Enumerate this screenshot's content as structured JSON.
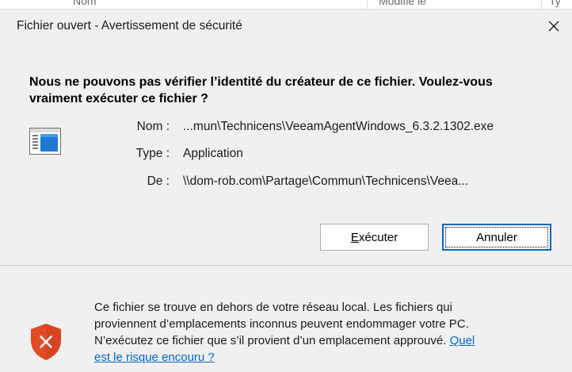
{
  "background_window": {
    "col1": "Nom",
    "col2": "Modifié le",
    "col3": "Ty"
  },
  "dialog": {
    "title": "Fichier ouvert - Avertissement de sécurité",
    "heading_line1": "Nous ne pouvons pas vérifier l’identité du créateur de ce fichier. Voulez-vous",
    "heading_line2": "vraiment exécuter ce fichier ?",
    "file_icon": "application-window-icon",
    "fields": [
      {
        "label": "Nom :",
        "value": "...mun\\Technicens\\VeeamAgentWindows_6.3.2.1302.exe"
      },
      {
        "label": "Type :",
        "value": "Application"
      },
      {
        "label": "De :",
        "value": "\\\\dom-rob.com\\Partage\\Commun\\Technicens\\Veea..."
      }
    ],
    "buttons": {
      "run_accel": "E",
      "run_rest": "xécuter",
      "cancel": "Annuler"
    },
    "footer": {
      "icon": "shield-warning-icon",
      "text_line1": "Ce fichier se trouve en dehors de votre réseau local. Les fichiers qui",
      "text_line2": "proviennent d’emplacements inconnus peuvent endommager votre PC.",
      "text_line3": "N’exécutez ce fichier que s’il provient d’un emplacement approuvé.",
      "link_part1": "Quel",
      "link_part2": "est le risque encouru ?"
    },
    "colors": {
      "accent": "#0067c0",
      "link": "#0066cc",
      "shield": "#e24b26",
      "background": "#f0f0f0"
    }
  }
}
